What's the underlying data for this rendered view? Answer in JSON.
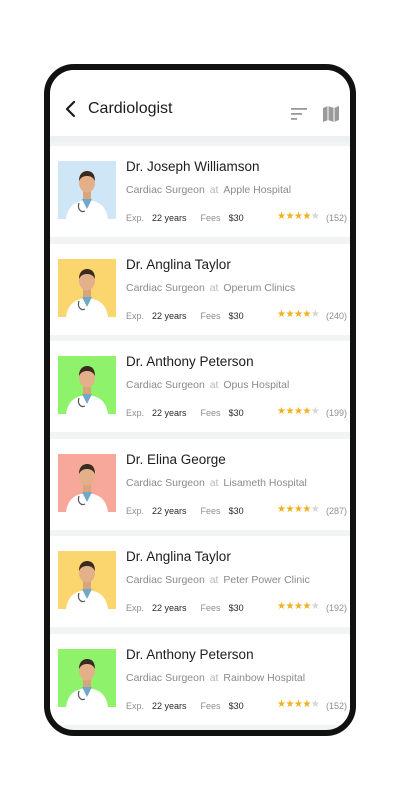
{
  "header": {
    "title": "Cardiologist",
    "icons": [
      "back-arrow-icon",
      "filter-sort-icon",
      "map-icon"
    ]
  },
  "labels": {
    "experience": "Exp.",
    "fees": "Fees",
    "at": "at"
  },
  "doctors": [
    {
      "name": "Dr. Joseph Williamson",
      "specialty": "Cardiac Surgeon",
      "hospital": "Apple Hospital",
      "experience": "22 years",
      "fees": "$30",
      "rating": 4,
      "reviews": "(152)",
      "photo_bg": "#cfe6f7"
    },
    {
      "name": "Dr. Anglina Taylor",
      "specialty": "Cardiac Surgeon",
      "hospital": "Operum Clinics",
      "experience": "22 years",
      "fees": "$30",
      "rating": 4,
      "reviews": "(240)",
      "photo_bg": "#fbd66e"
    },
    {
      "name": "Dr. Anthony Peterson",
      "specialty": "Cardiac Surgeon",
      "hospital": "Opus Hospital",
      "experience": "22 years",
      "fees": "$30",
      "rating": 4,
      "reviews": "(199)",
      "photo_bg": "#8ef36a"
    },
    {
      "name": "Dr. Elina George",
      "specialty": "Cardiac Surgeon",
      "hospital": "Lisameth Hospital",
      "experience": "22 years",
      "fees": "$30",
      "rating": 4,
      "reviews": "(287)",
      "photo_bg": "#f7a89a"
    },
    {
      "name": "Dr. Anglina Taylor",
      "specialty": "Cardiac Surgeon",
      "hospital": "Peter Power Clinic",
      "experience": "22 years",
      "fees": "$30",
      "rating": 4,
      "reviews": "(192)",
      "photo_bg": "#fbd66e"
    },
    {
      "name": "Dr. Anthony Peterson",
      "specialty": "Cardiac Surgeon",
      "hospital": "Rainbow Hospital",
      "experience": "22 years",
      "fees": "$30",
      "rating": 4,
      "reviews": "(152)",
      "photo_bg": "#8ef36a"
    }
  ]
}
